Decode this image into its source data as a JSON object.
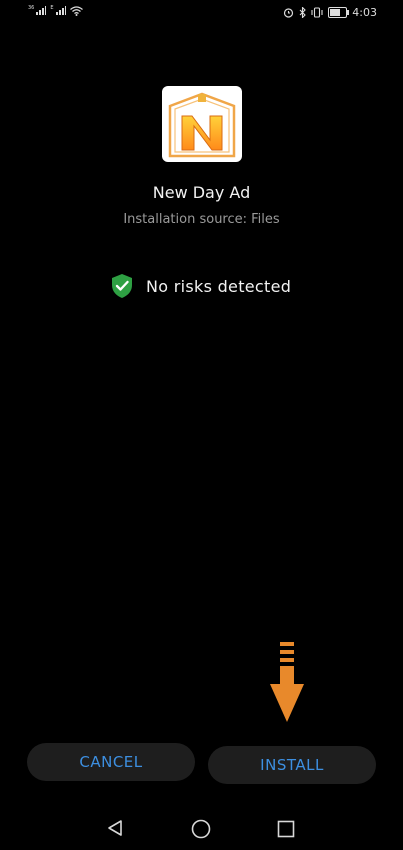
{
  "status_bar": {
    "sim1_label": "36",
    "sim2_label": "E",
    "time": "4:03",
    "icons": [
      "signal-icon",
      "wifi-icon",
      "alarm-icon",
      "bluetooth-icon",
      "vibrate-icon",
      "battery-icon"
    ],
    "battery_level": 0.58
  },
  "app": {
    "name": "New Day Ad",
    "source": "Installation source: Files",
    "icon": "app-logo-icon"
  },
  "security": {
    "status_text": "No risks detected",
    "icon": "shield-check-icon",
    "color": "#2ea043"
  },
  "annotation": {
    "icon": "arrow-down-icon",
    "color": "#e8892b"
  },
  "buttons": {
    "cancel_label": "CANCEL",
    "install_label": "INSTALL",
    "label_color": "#3d8fe0"
  },
  "nav": {
    "icons": [
      "back-icon",
      "home-icon",
      "recent-apps-icon"
    ]
  }
}
